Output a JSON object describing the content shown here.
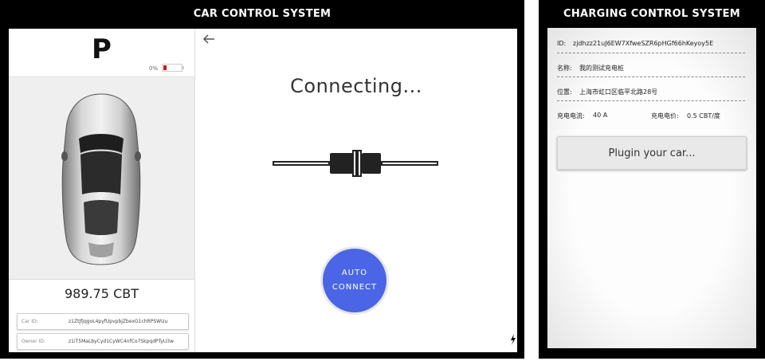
{
  "car_system": {
    "title": "CAR CONTROL SYSTEM",
    "gear": "P",
    "battery_percent": "0%",
    "battery_level": 0.05,
    "balance": "989.75 CBT",
    "car_id_label": "Car     ID:",
    "car_id": "z1ZtJfjqgoL4pyfUpvpbjZbexG1chRPSWUu",
    "owner_id_label": "Owner  ID:",
    "owner_id": "z1iT5MaLbyCyd1CyWC4nfCo7SkpqdPTyU3w",
    "status": "Connecting...",
    "auto_connect_line1": "AUTO",
    "auto_connect_line2": "CONNECT",
    "icons": [
      "back-arrow-icon",
      "plug-cable-icon",
      "car-top-view-icon",
      "lightning-bolt-icon"
    ],
    "accent_color": "#4a66e6"
  },
  "charging_system": {
    "title": "CHARGING CONTROL SYSTEM",
    "id_label": "ID:",
    "id_value": "zjdhzz21uJ6EW7XfweSZR6pHGf66hKeyoy5E",
    "name_label": "名称:",
    "name_value": "我的测试充电桩",
    "location_label": "位置:",
    "location_value": "上海市虹口区临平北路28号",
    "current_label": "充电电流:",
    "current_value": "40 A",
    "price_label": "充电电价:",
    "price_value": "0.5 CBT/度",
    "plugin_button": "Plugin your car..."
  }
}
